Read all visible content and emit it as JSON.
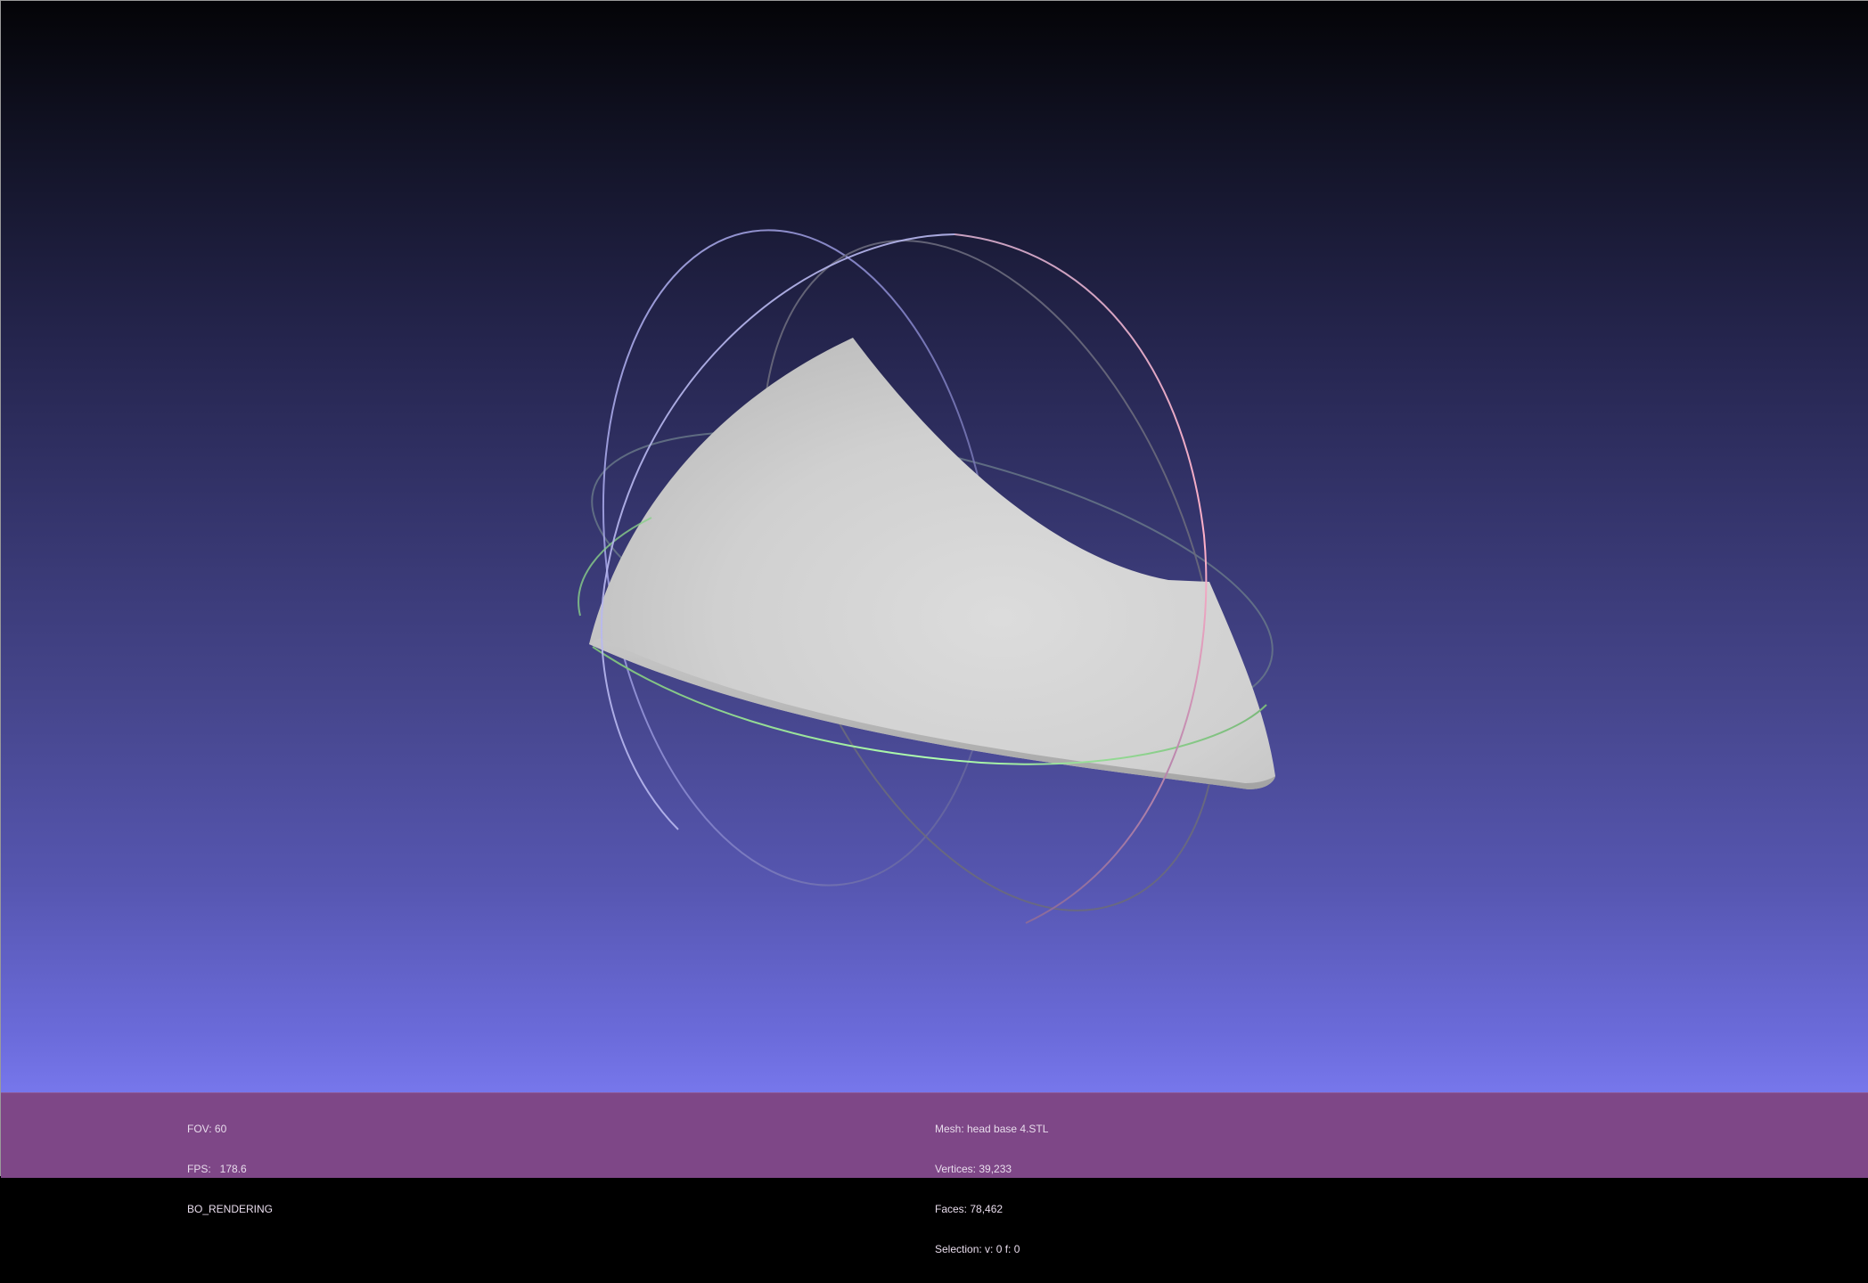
{
  "viewer": {
    "background_top": "#040407",
    "background_bottom": "#7777ec",
    "info_bar_color": "#7e4787",
    "mesh_color": "#d4d4d4",
    "trackball_colors": {
      "x_ring": "#ffb0c0",
      "y_ring": "#b0ffb0",
      "z_ring": "#b8b8ff"
    }
  },
  "info_left": {
    "fov": "FOV: 60",
    "fps": "FPS:   178.6",
    "mode": "BO_RENDERING"
  },
  "info_right": {
    "mesh": "Mesh: head base 4.STL",
    "vertices": "Vertices: 39,233",
    "faces": "Faces: 78,462",
    "selection": "Selection: v: 0 f: 0"
  }
}
